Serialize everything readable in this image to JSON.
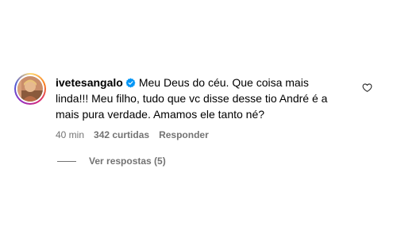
{
  "comment": {
    "username": "ivetesangalo",
    "verified": true,
    "text": "Meu Deus do céu. Que coisa mais linda!!! Meu filho, tudo que vc disse desse tio André é a mais pura verdade. Amamos ele tanto né?",
    "time": "40 min",
    "likes": "342 curtidas",
    "reply_label": "Responder"
  },
  "replies": {
    "label": "Ver respostas (5)"
  },
  "icons": {
    "like": "heart-outline-icon",
    "verified": "verified-badge-icon"
  },
  "colors": {
    "verified": "#0095f6",
    "muted": "#737373"
  }
}
